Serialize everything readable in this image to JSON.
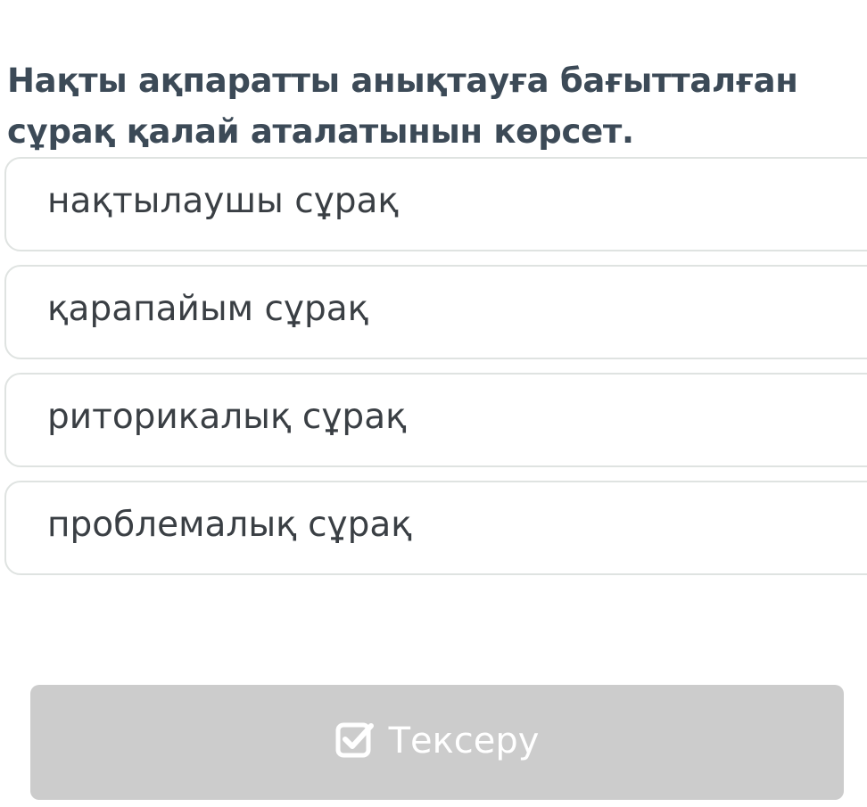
{
  "question": {
    "text": "Нақты ақпаратты анықтауға бағытталған сұрақ қалай аталатынын көрсет."
  },
  "options": [
    {
      "label": "нақтылаушы сұрақ"
    },
    {
      "label": "қарапайым сұрақ"
    },
    {
      "label": "риторикалық сұрақ"
    },
    {
      "label": "проблемалық сұрақ"
    }
  ],
  "check_button": {
    "label": "Тексеру",
    "icon": "checkbox-checked-icon",
    "background_color": "#cccccc",
    "text_color": "#ffffff"
  },
  "colors": {
    "question_text": "#3c4a57",
    "option_border": "#dfe3e1",
    "option_text": "#3a3f44"
  }
}
